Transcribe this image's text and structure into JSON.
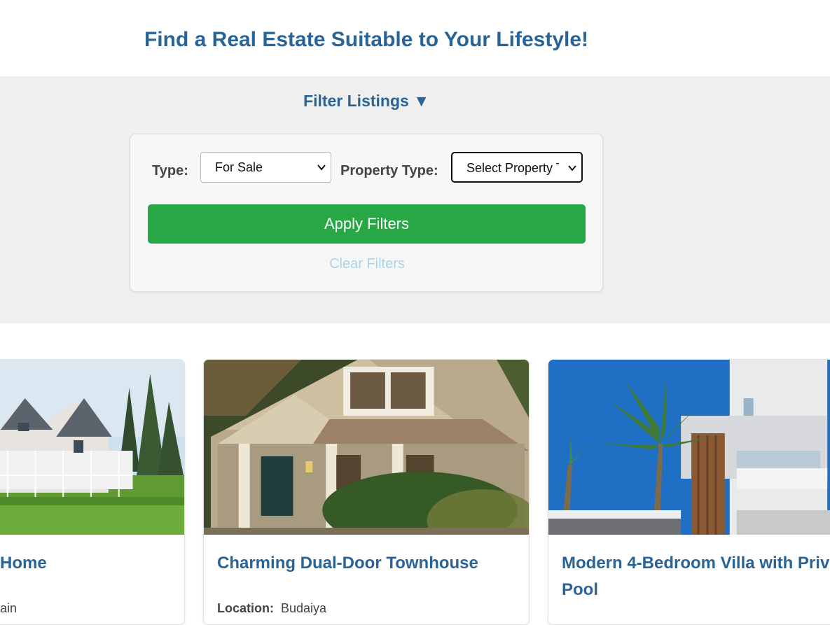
{
  "header": {
    "title": "Find a Real Estate Suitable to Your Lifestyle!"
  },
  "filters": {
    "toggle_label": "Filter Listings ▼",
    "type_label": "Type:",
    "type_value": "For Sale",
    "property_type_label": "Property Type:",
    "property_type_value": "Select Property Type",
    "apply_label": "Apply Filters",
    "clear_label": "Clear Filters"
  },
  "listings": [
    {
      "title": "Home",
      "location_label": "",
      "location": "ain"
    },
    {
      "title": "Charming Dual-Door Townhouse",
      "location_label": "Location:",
      "location": "Budaiya"
    },
    {
      "title_line1": "Modern 4-Bedroom Villa with Priv",
      "title_line2": "Pool"
    }
  ],
  "colors": {
    "accent": "#2a6496",
    "apply": "#28a745",
    "clear": "#a9d4e8",
    "band": "#efefef"
  }
}
